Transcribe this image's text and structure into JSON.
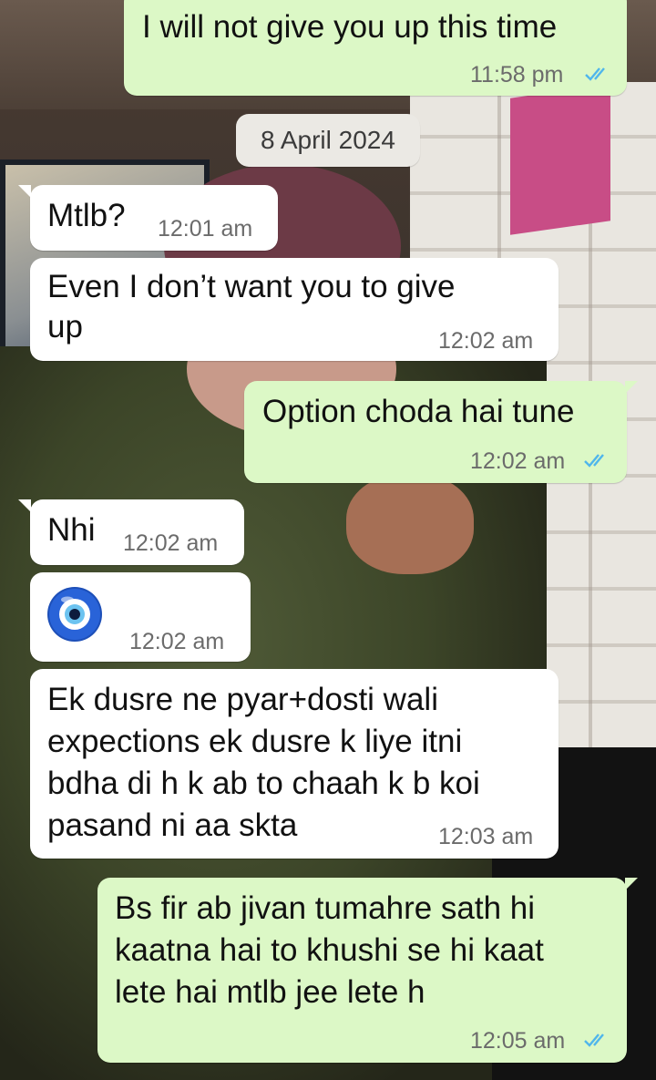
{
  "chat": {
    "date_divider": "8 April 2024",
    "messages": [
      {
        "direction": "outgoing",
        "text": "I will not give you up this time",
        "time": "11:58 pm",
        "status": "read"
      },
      {
        "direction": "incoming",
        "text": "Mtlb?",
        "time": "12:01 am"
      },
      {
        "direction": "incoming",
        "lines": [
          "Even I don’t want you to give",
          "up"
        ],
        "time": "12:02 am"
      },
      {
        "direction": "outgoing",
        "text": "Option choda hai tune",
        "time": "12:02 am",
        "status": "read"
      },
      {
        "direction": "incoming",
        "text": "Nhi",
        "time": "12:02 am"
      },
      {
        "direction": "incoming",
        "emoji": "nazar-amulet-icon",
        "time": "12:02 am"
      },
      {
        "direction": "incoming",
        "lines": [
          "Ek dusre ne pyar+dosti wali",
          "expections ek dusre k liye itni",
          "bdha di h k ab to chaah k b koi",
          "pasand ni aa skta"
        ],
        "time": "12:03 am"
      },
      {
        "direction": "outgoing",
        "lines": [
          "Bs fir ab jivan tumahre sath hi",
          "kaatna hai to khushi se hi kaat",
          "lete hai mtlb jee lete h"
        ],
        "time": "12:05 am",
        "status": "read"
      }
    ]
  },
  "colors": {
    "incoming_bubble": "#ffffff",
    "outgoing_bubble": "#dcf8c6",
    "read_ticks": "#4fb6ec",
    "timestamp": "#6b6b6b"
  }
}
